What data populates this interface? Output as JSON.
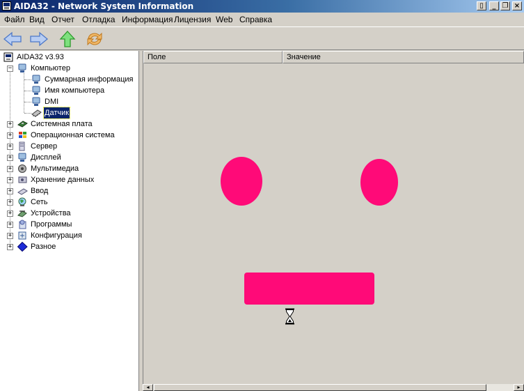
{
  "window": {
    "title": "AIDA32 - Network System Information",
    "controls": [
      "▯",
      "_",
      "❐",
      "×"
    ]
  },
  "menu": [
    "Файл",
    "Вид",
    "Отчет",
    "Отладка",
    "Информация",
    "Лицензия",
    "Web",
    "Справка"
  ],
  "toolbar": {
    "buttons": [
      "back-icon",
      "forward-icon",
      "up-icon",
      "refresh-icon"
    ]
  },
  "tree": {
    "root": "AIDA32 v3.93",
    "computer": {
      "label": "Компьютер",
      "children": [
        "Суммарная информация",
        "Имя компьютера",
        "DMI",
        "Датчик"
      ],
      "selected": "Датчик"
    },
    "items": [
      "Системная плата",
      "Операционная система",
      "Сервер",
      "Дисплей",
      "Мультимедиа",
      "Хранение данных",
      "Ввод",
      "Сеть",
      "Устройства",
      "Программы",
      "Конфигурация",
      "Разное"
    ]
  },
  "list": {
    "columns": [
      "Поле",
      "Значение"
    ]
  },
  "colors": {
    "shape_fill": "#ff0a78",
    "titlebar_start": "#0a246a",
    "selection": "#0a246a"
  },
  "cursor": "hourglass-icon"
}
